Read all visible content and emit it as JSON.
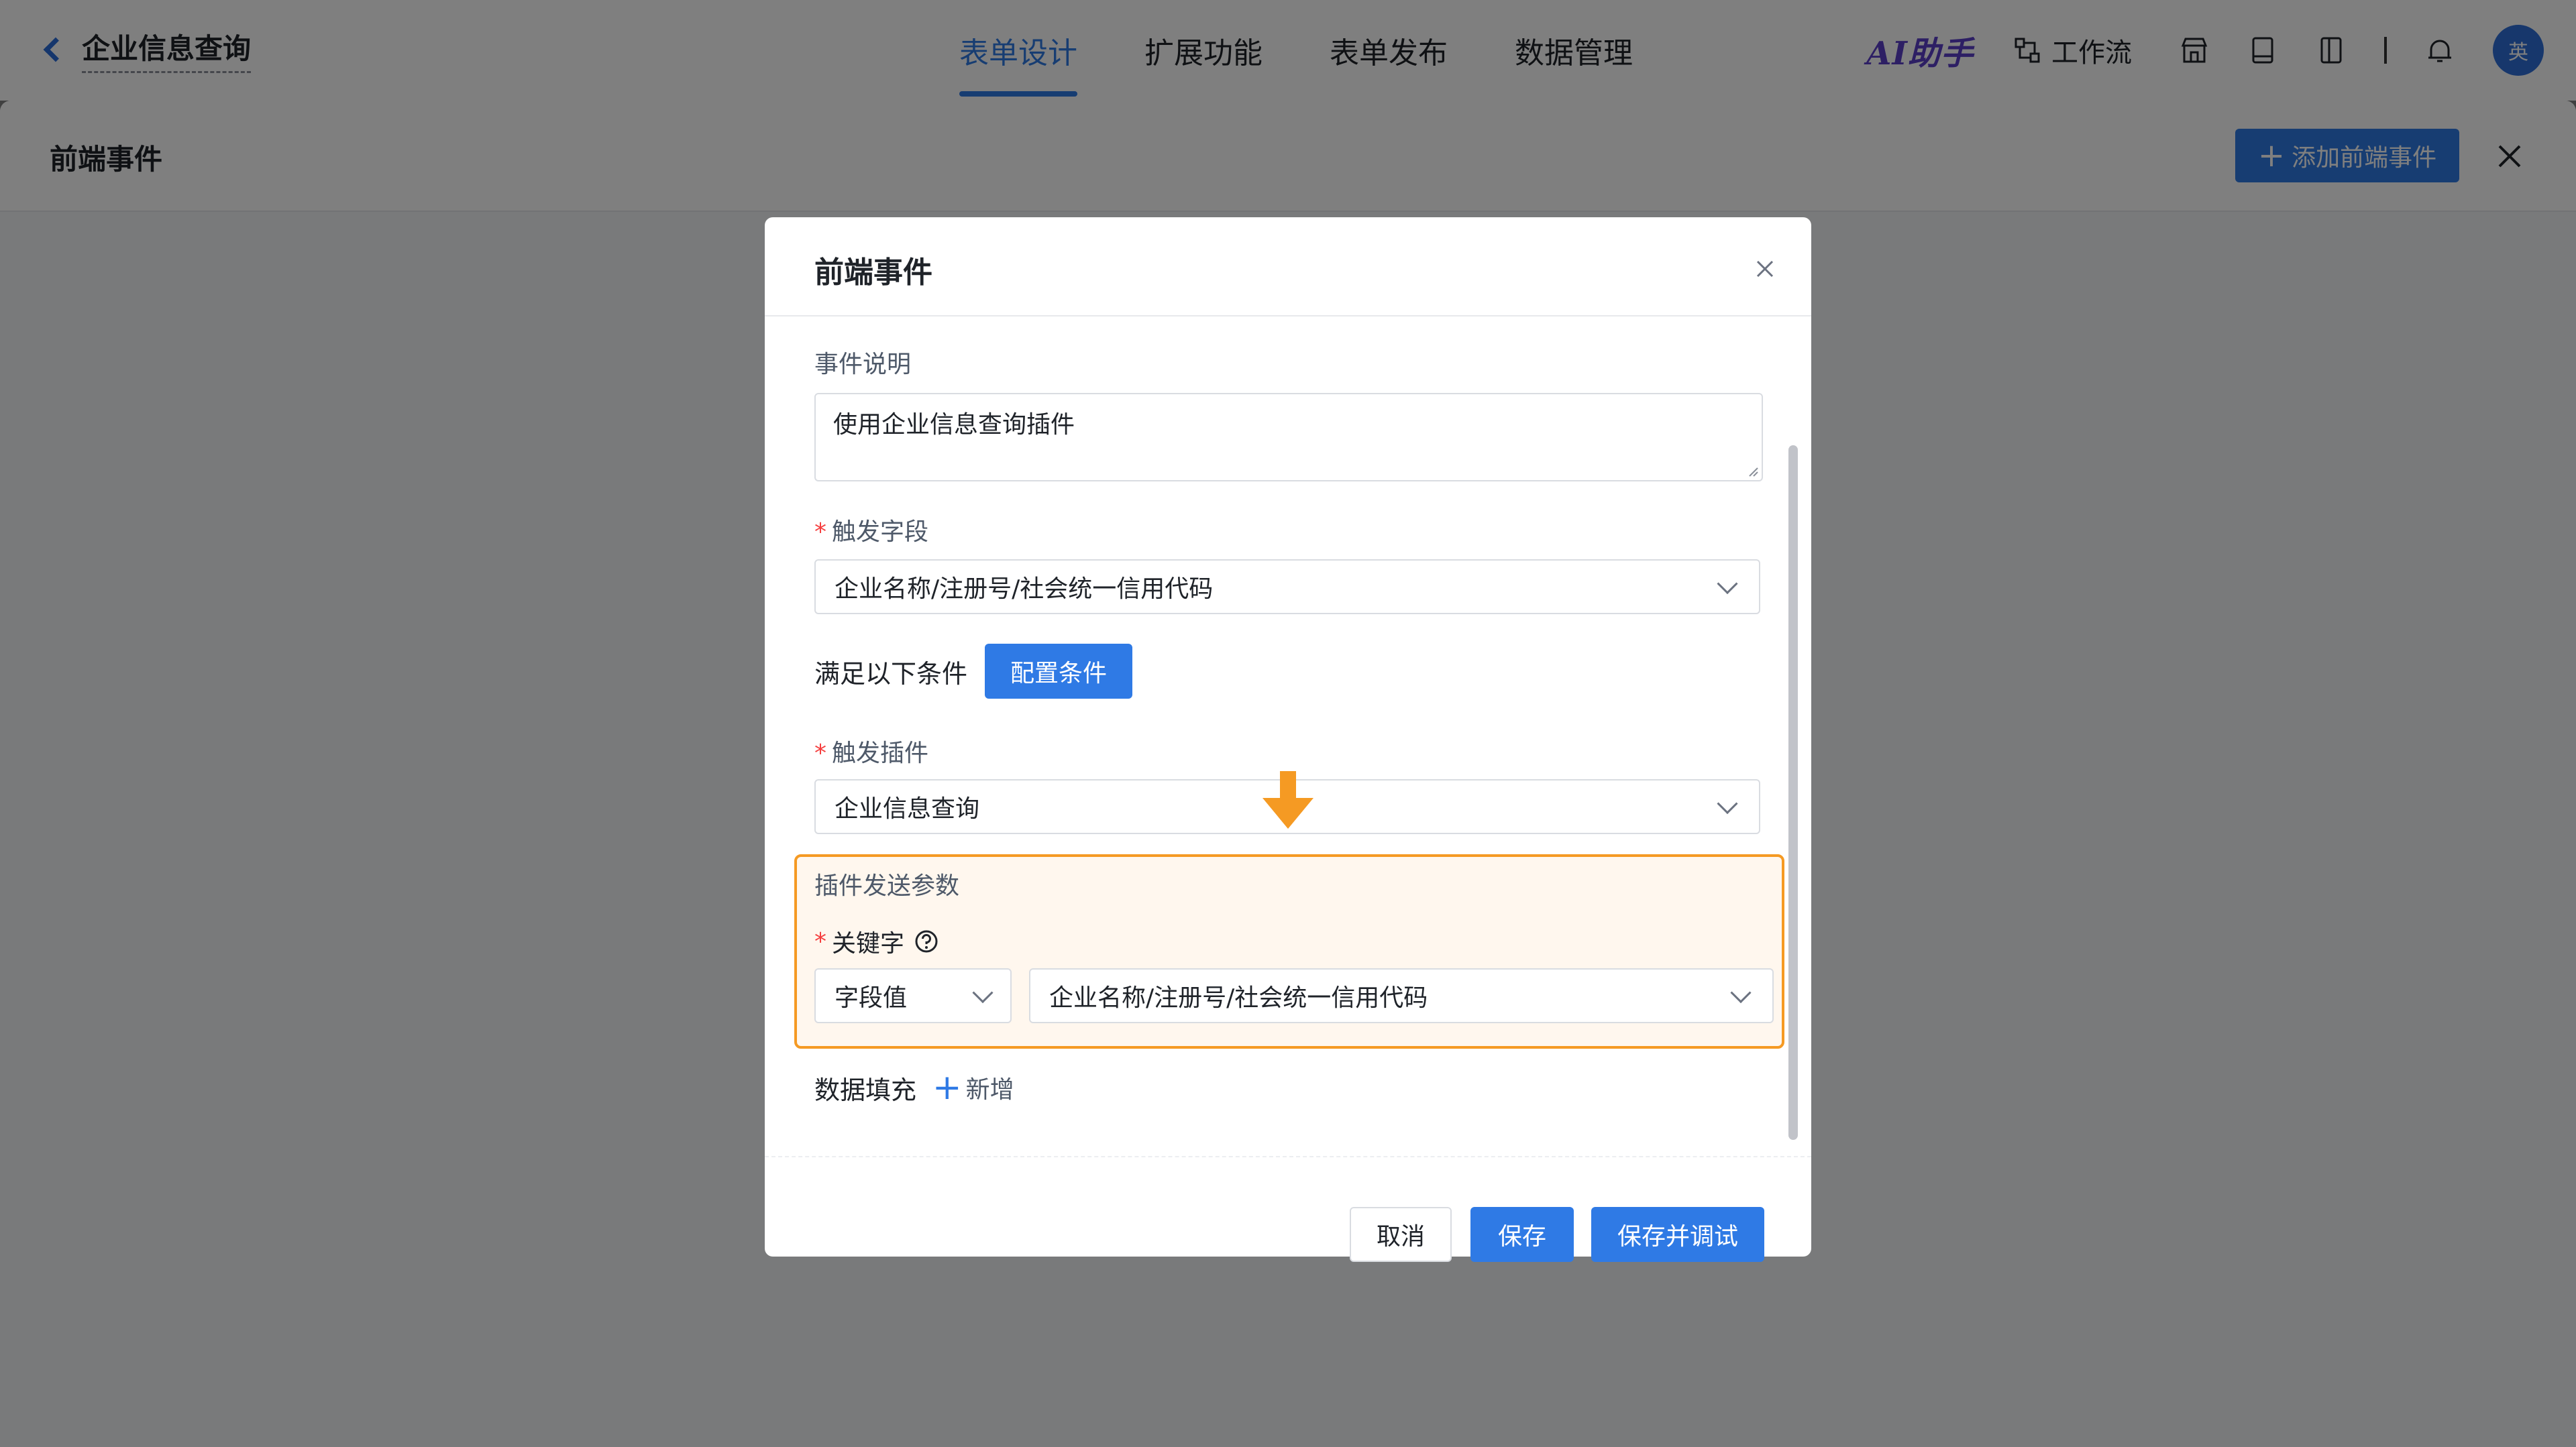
{
  "topbar": {
    "app_title": "企业信息查询",
    "tabs": [
      {
        "label": "表单设计",
        "active": true
      },
      {
        "label": "扩展功能",
        "active": false
      },
      {
        "label": "表单发布",
        "active": false
      },
      {
        "label": "数据管理",
        "active": false
      }
    ],
    "ai_assistant": "AI助手",
    "workflow": "工作流",
    "avatar_text": "英",
    "icons": [
      "store-icon",
      "book-icon",
      "panel-icon",
      "bell-icon"
    ]
  },
  "drawer": {
    "title": "前端事件",
    "add_button": "添加前端事件"
  },
  "modal": {
    "title": "前端事件",
    "event_desc_label": "事件说明",
    "event_desc_value": "使用企业信息查询插件",
    "trigger_field_label": "触发字段",
    "trigger_field_value": "企业名称/注册号/社会统一信用代码",
    "condition_label": "满足以下条件",
    "config_condition_button": "配置条件",
    "trigger_plugin_label": "触发插件",
    "trigger_plugin_value": "企业信息查询",
    "plugin_params_title": "插件发送参数",
    "keyword_label": "关键字",
    "keyword_value_type": "字段值",
    "keyword_field_value": "企业名称/注册号/社会统一信用代码",
    "data_fill_label": "数据填充",
    "data_fill_add": "新增",
    "cancel_button": "取消",
    "save_button": "保存",
    "save_debug_button": "保存并调试"
  },
  "colors": {
    "primary": "#2f7ae5",
    "highlight_border": "#f59a23",
    "required": "#f53f3f"
  }
}
